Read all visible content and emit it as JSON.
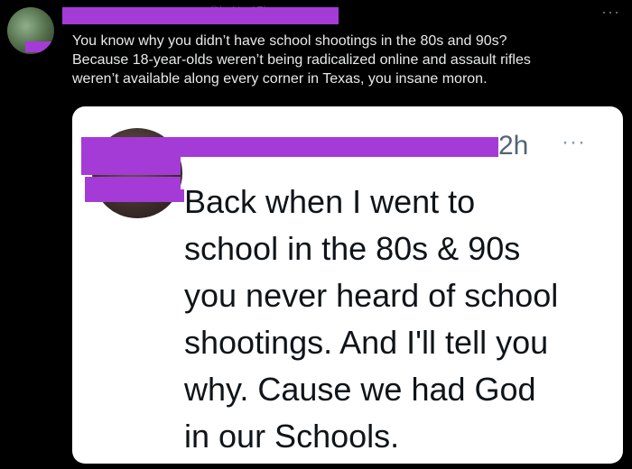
{
  "tweet": {
    "more_icon": "ellipsis-icon",
    "more_label": "···",
    "author_fragment": "@l...N...17l...",
    "text_lines": [
      "You know why you didn’t have school shootings in the 80s and 90s?",
      "Because 18-year-olds weren’t being radicalized online and assault rifles",
      "weren’t available along every corner in Texas, you insane moron."
    ]
  },
  "quote": {
    "time": "2h",
    "more_label": "···",
    "more_icon": "ellipsis-icon",
    "text_lines": [
      "Back when I went to",
      "school in the 80s & 90s",
      "you never heard of school",
      "shootings. And I'll tell you",
      "why. Cause we had God",
      "in our Schools."
    ]
  },
  "colors": {
    "background": "#000000",
    "redaction": "#a43bd6",
    "text_light": "#e7e9ea",
    "text_dark": "#0f1419",
    "muted": "#536471"
  }
}
